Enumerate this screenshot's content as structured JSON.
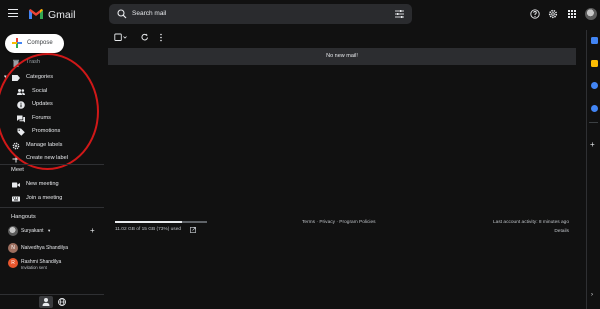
{
  "header": {
    "app_name": "Gmail",
    "search_placeholder": "Search mail",
    "icons": [
      "main-menu-icon",
      "help-icon",
      "settings-icon",
      "apps-icon",
      "avatar"
    ]
  },
  "compose": {
    "label": "Compose"
  },
  "sidebar": {
    "trash_label": "Trash",
    "categories_label": "Categories",
    "items": [
      {
        "label": "Social",
        "icon": "people-icon"
      },
      {
        "label": "Updates",
        "icon": "info-icon"
      },
      {
        "label": "Forums",
        "icon": "forum-icon"
      },
      {
        "label": "Promotions",
        "icon": "tag-icon"
      }
    ],
    "manage_labels": "Manage labels",
    "create_label": "Create new label"
  },
  "meet": {
    "title": "Meet",
    "new_meeting": "New meeting",
    "join_meeting": "Join a meeting"
  },
  "hangouts": {
    "title": "Hangouts",
    "user": "Suryakant",
    "contacts": [
      {
        "name": "Naivedhya Shandilya",
        "initial": "N",
        "status": ""
      },
      {
        "name": "Rashmi Shandilya",
        "initial": "R",
        "status": "Invitation sent"
      }
    ]
  },
  "main": {
    "banner": "No new mail!",
    "storage_text": "11.02 GB of 15 GB (73%) used",
    "storage_fraction": 0.73,
    "footer_links": "Terms · Privacy · Program Policies",
    "last_activity": "Last account activity: 8 minutes ago",
    "details": "Details"
  },
  "colors": {
    "background": "#111111",
    "annotation": "#d01818",
    "gmail_red": "#ea4335",
    "gmail_blue": "#4285f4",
    "gmail_yellow": "#fbbc04",
    "gmail_green": "#34a853"
  }
}
